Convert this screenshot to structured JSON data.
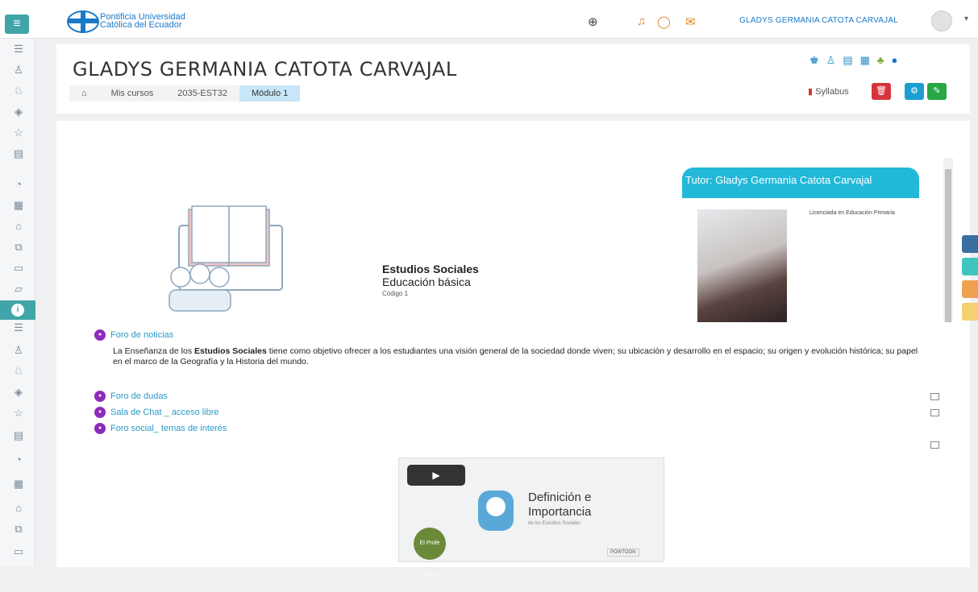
{
  "navbar": {
    "brand_line1": "Pontificia Universidad",
    "brand_line2": "Católica del Ecuador",
    "user_name": "GLADYS GERMANIA CATOTA CARVAJAL",
    "icons": [
      "globe-icon",
      "bell-icon",
      "chat-icon",
      "mail-icon"
    ]
  },
  "sidebar": {
    "icons": [
      "list-icon",
      "users-icon",
      "contacts-icon",
      "layers-icon",
      "star-icon",
      "book-icon",
      "gauge-icon",
      "calendar-icon",
      "graduation-icon",
      "copy-icon",
      "clipboard-icon",
      "folder-icon"
    ]
  },
  "header": {
    "title": "GLADYS GERMANIA CATOTA CARVAJAL",
    "breadcrumb": [
      "Mis cursos",
      "2035-EST32",
      "Módulo 1"
    ],
    "syllabus_label": "Syllabus"
  },
  "tutor": {
    "title": "Tutor: Gladys Germania Catota Carvajal",
    "description": "Licenciada en Educación Primaria"
  },
  "course": {
    "name": "Estudios Sociales",
    "level": "Educación básica",
    "code": "Código 1"
  },
  "activities": {
    "news": "Foro de noticias",
    "description_pre": "La Enseñanza de los ",
    "description_bold": "Estudios Sociales",
    "description_post": " tiene como objetivo ofrecer a los estudiantes una visión general de la sociedad donde viven; su ubicación y desarrollo en el espacio; su origen y evolución histórica; su papel en el marco de la Geografía y la Historia del mundo.",
    "doubts": "Foro de dudas",
    "chat": "Sala de Chat _ acceso libre",
    "social": "Foro social_ temas de interés"
  },
  "video": {
    "title_line1": "Definición e",
    "title_line2": "Importancia",
    "subtitle": "de los Estudios Sociales",
    "badge": "El Profe Carlos",
    "brand": "POWTOON"
  },
  "colors": {
    "accent": "#3fa5a8",
    "link": "#1a79c8",
    "tutor_header": "#22b8d8",
    "delete_button": "#d8343c",
    "settings_button": "#1a9fd0",
    "edit_button": "#28a745",
    "forum_icon": "#8e2bbd"
  }
}
